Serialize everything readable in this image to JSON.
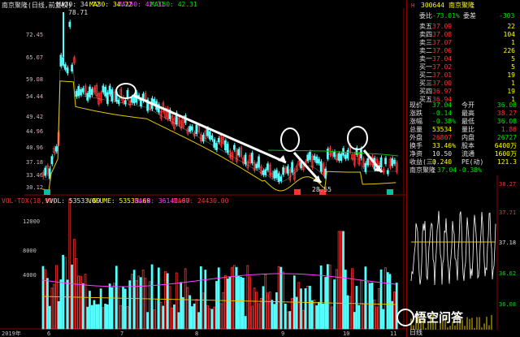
{
  "main_chart": {
    "title": "南京聚隆(日线,前复权)",
    "ma30_label": "MA30: 34.72",
    "ma30_2_label": "MA30: 34.72",
    "ma150_label": "MA150: 42.31",
    "ma150_2_label": "MA150: 42.31",
    "peak_label": "78.71",
    "low_label": "28.55",
    "y_ticks": [
      "72.45",
      "65.07",
      "59.88",
      "54.44",
      "49.42",
      "44.96",
      "40.96",
      "37.18",
      "33.46",
      "30.12"
    ],
    "vol_header": "VOL-TDX(18,90)",
    "vvol_label": "VVOL: 53533.69",
    "volume_label": "VOLUME: 53533.69",
    "ma18_label": "MA18: 36141.67",
    "ma90_label": "MA90: 24430.00",
    "vol_y_ticks": [
      "12000",
      "8000",
      "4000"
    ],
    "date_labels": [
      "2019年",
      "6",
      "7",
      "8",
      "9",
      "10",
      "11",
      "12"
    ],
    "markers": [
      "低",
      "高",
      "高",
      "低"
    ],
    "colors": {
      "up": "#ff3232",
      "down": "#54ffff",
      "ma_yellow": "#e6c800",
      "ma_green": "#00c000",
      "ma_magenta": "#ff40ff"
    }
  },
  "panel": {
    "code": "300644",
    "name": "南京聚隆",
    "ratio_label": "委比",
    "ratio_value": "-73.01%",
    "diff_label": "委差",
    "diff_value": "-303",
    "sell": [
      {
        "label": "卖五",
        "price": "37.09",
        "vol": "22"
      },
      {
        "label": "卖四",
        "price": "37.08",
        "vol": "104"
      },
      {
        "label": "卖三",
        "price": "37.07",
        "vol": "1"
      },
      {
        "label": "卖二",
        "price": "37.06",
        "vol": "226"
      },
      {
        "label": "卖一",
        "price": "37.04",
        "vol": "5"
      }
    ],
    "buy": [
      {
        "label": "买一",
        "price": "37.02",
        "vol": "5"
      },
      {
        "label": "买二",
        "price": "37.01",
        "vol": "19"
      },
      {
        "label": "买三",
        "price": "37.00",
        "vol": "1"
      },
      {
        "label": "买四",
        "price": "36.97",
        "vol": "19"
      },
      {
        "label": "买五",
        "price": "36.94",
        "vol": "1"
      }
    ],
    "stats": [
      {
        "l1": "现价",
        "v1": "37.04",
        "l2": "今开",
        "v2": "36.08"
      },
      {
        "l1": "涨跌",
        "v1": "-0.14",
        "l2": "最高",
        "v2": "38.27"
      },
      {
        "l1": "涨幅",
        "v1": "-0.38%",
        "l2": "最低",
        "v2": "36.08"
      },
      {
        "l1": "总量",
        "v1": "53534",
        "l2": "量比",
        "v2": "1.86"
      },
      {
        "l1": "外盘",
        "v1": "26807",
        "l2": "内盘",
        "v2": "26727"
      },
      {
        "l1": "换手",
        "v1": "33.46%",
        "l2": "股本",
        "v2": "6400万"
      },
      {
        "l1": "净资",
        "v1": "10.50",
        "l2": "流通",
        "v2": "1600万"
      },
      {
        "l1": "收益(三)",
        "v1": "0.240",
        "l2": "PE(动)",
        "v2": "121.3"
      }
    ],
    "mini_title": "南京聚隆",
    "mini_price": "37.04",
    "mini_change": "-0.38%",
    "mini_ticks": [
      "38.27",
      "37.71",
      "37.18",
      "36.62",
      "36.08"
    ],
    "mini_date": "日线"
  },
  "watermark": "悟空问答"
}
